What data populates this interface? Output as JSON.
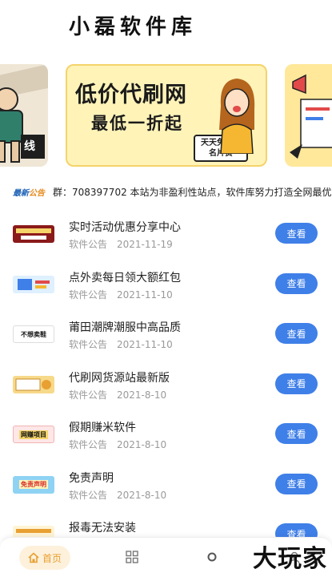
{
  "app": {
    "title": "小磊软件库"
  },
  "banner": {
    "main_line1": "低价代刷网",
    "main_line2": "最低一折起",
    "main_badge": "天天免费领名片赞",
    "left_label": "线"
  },
  "notice": {
    "tag_part1": "最新",
    "tag_part2": "公告",
    "text": "群：708397702 本站为非盈利性站点，软件库努力打造全网最优"
  },
  "list": {
    "button_label": "查看",
    "items": [
      {
        "title": "实时活动优惠分享中心",
        "category": "软件公告",
        "date": "2021-11-19"
      },
      {
        "title": "点外卖每日领大额红包",
        "category": "软件公告",
        "date": "2021-11-10"
      },
      {
        "title": "莆田潮牌潮服中高品质",
        "category": "软件公告",
        "date": "2021-11-10"
      },
      {
        "title": "代刷网货源站最新版",
        "category": "软件公告",
        "date": "2021-8-10"
      },
      {
        "title": "假期赚米软件",
        "category": "软件公告",
        "date": "2021-8-10"
      },
      {
        "title": "免责声明",
        "category": "软件公告",
        "date": "2021-8-10"
      },
      {
        "title": "报毒无法安装",
        "category": "",
        "date": ""
      }
    ]
  },
  "thumbs": {
    "t3": "不想卖鞋",
    "t5": "网赚项目",
    "t6": "免责声明"
  },
  "tabbar": {
    "home_label": "首页"
  },
  "watermark": "大玩家",
  "colors": {
    "accent_blue": "#3f7fe8",
    "home_orange": "#e8a032"
  }
}
